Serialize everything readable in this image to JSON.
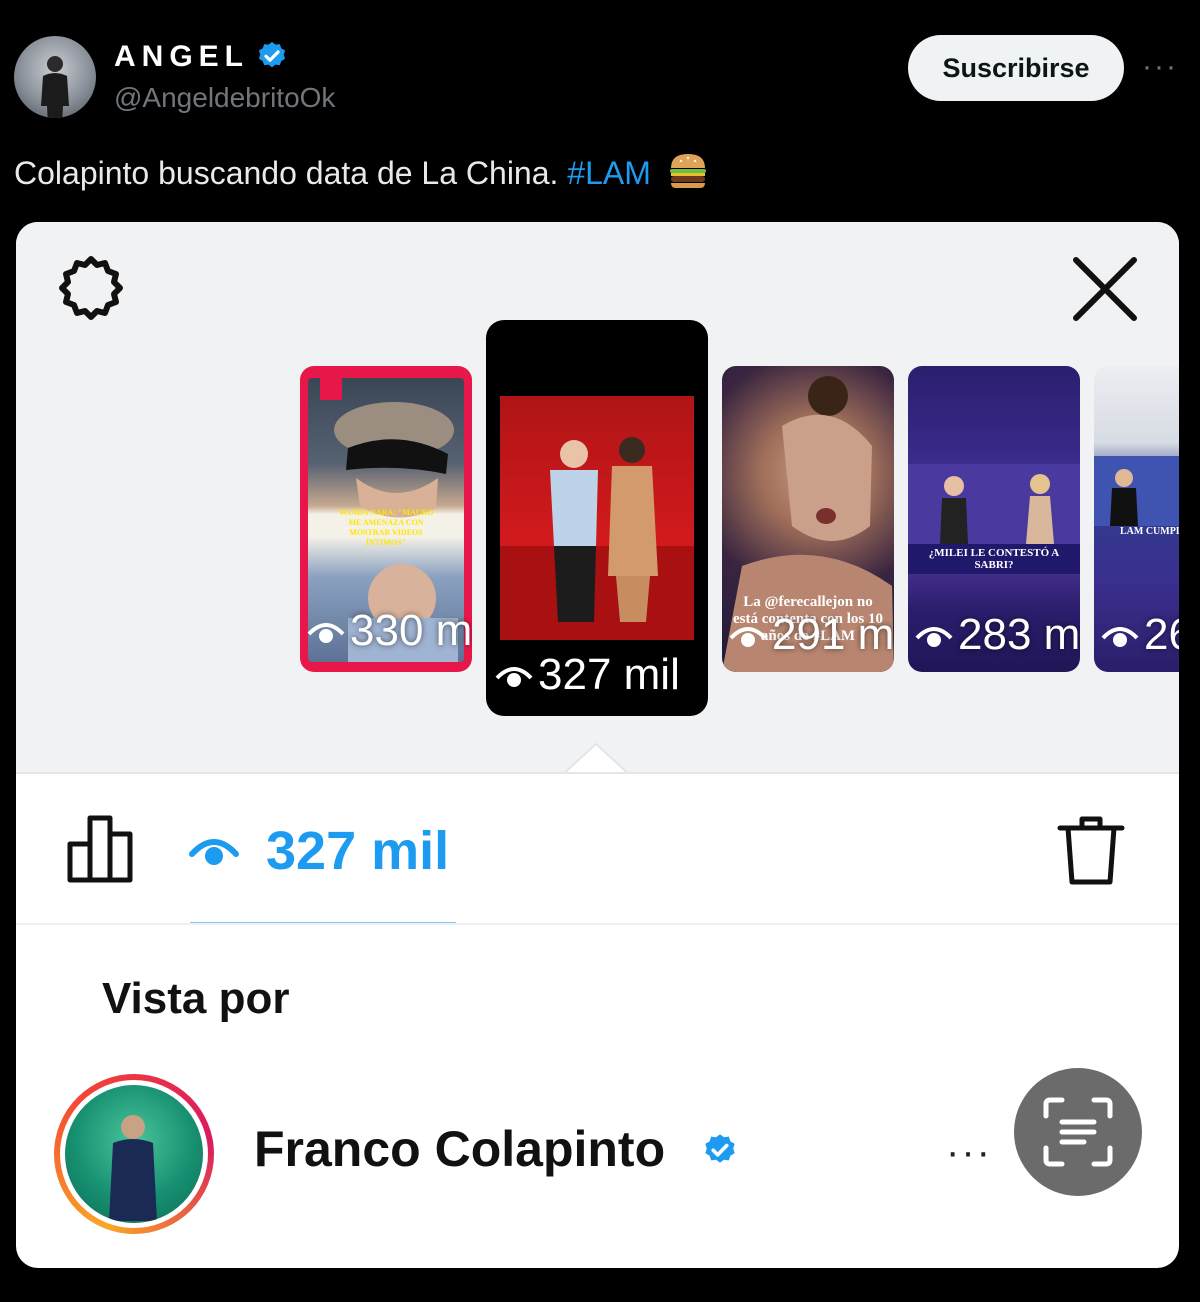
{
  "tweet": {
    "author_name": "ANGEL",
    "author_handle": "@AngeldebritoOk",
    "subscribe_label": "Suscribirse",
    "more_label": "···",
    "text_main": "Colapinto buscando data de La China. ",
    "hashtag": "#LAM",
    "emoji": "hamburger"
  },
  "stories": {
    "items": [
      {
        "views": "330 m",
        "caption": "WANDA NARA: \"MAURO ME AMENAZA CON MOSTRAR VIDEOS ÍNTIMOS\"",
        "selected": false
      },
      {
        "views": "327 mil",
        "caption": "",
        "selected": true
      },
      {
        "views": "291 m",
        "caption": "La @ferecallejon no está contenta con los 10 años de #LAM",
        "selected": false
      },
      {
        "views": "283 m",
        "caption": "¿MILEI LE CONTESTÓ A SABRI?",
        "selected": false
      },
      {
        "views": "26",
        "caption": "LAM CUMPLE",
        "selected": false
      }
    ]
  },
  "stats": {
    "views_count": "327 mil"
  },
  "viewers": {
    "section_title": "Vista por",
    "items": [
      {
        "name": "Franco Colapinto",
        "verified": true
      }
    ]
  },
  "icons": {
    "settings": "gear-icon",
    "close": "close-icon",
    "insights": "bar-chart-icon",
    "views": "eye-icon",
    "delete": "trash-icon",
    "more": "more-icon",
    "scan": "text-scan-icon"
  },
  "colors": {
    "background": "#000000",
    "link": "#1d9bf0",
    "story_ring": "#e8174a",
    "card_top": "#f1f2f4",
    "scan_button": "#6b6b6b"
  }
}
